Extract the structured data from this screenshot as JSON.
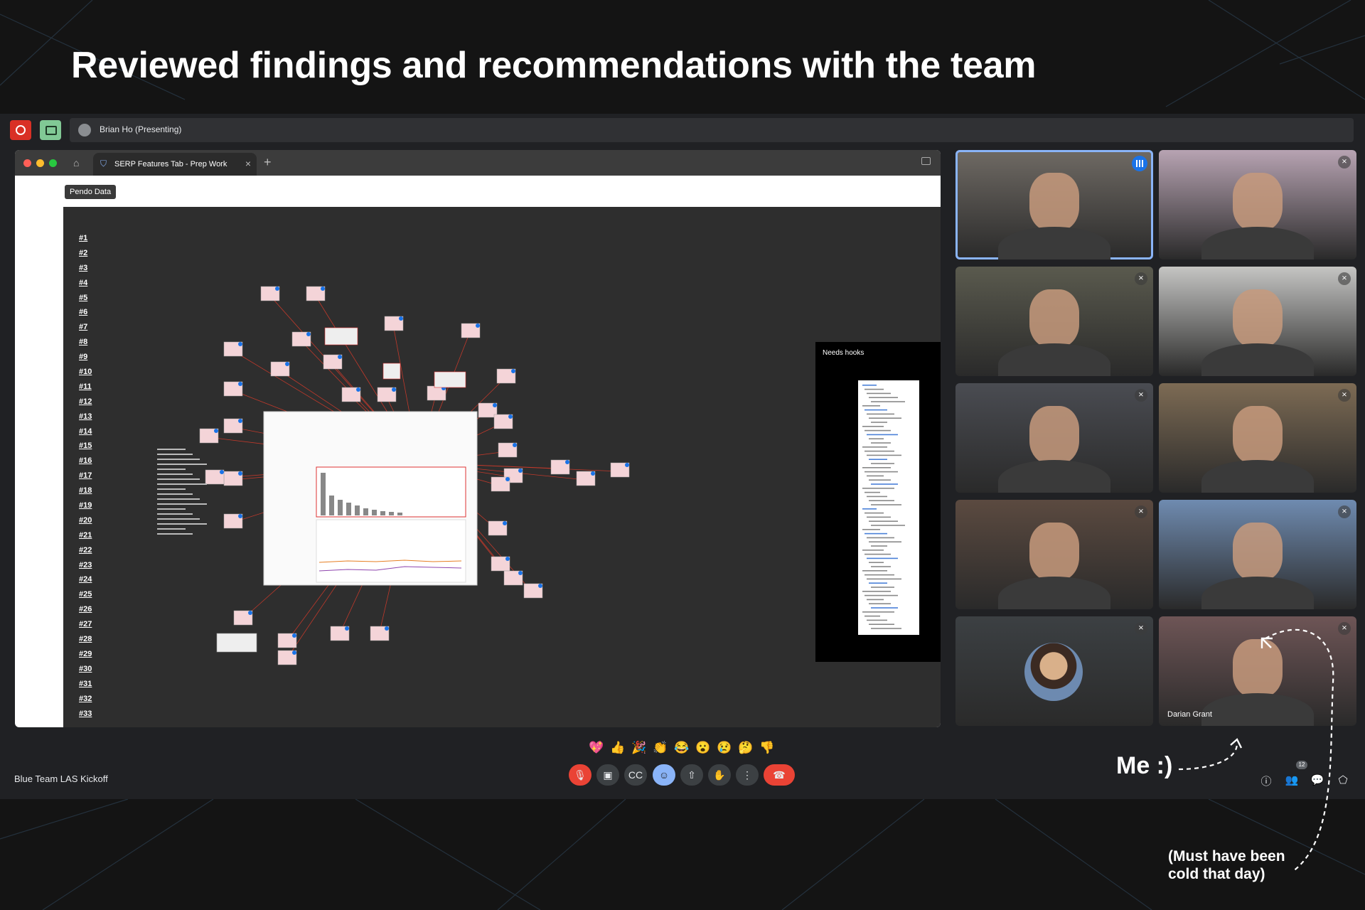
{
  "headline": "Reviewed findings and recommendations with the team",
  "meet": {
    "presenting_label": "Brian Ho (Presenting)",
    "meeting_title": "Blue Team LAS Kickoff",
    "participant_count": "12",
    "reactions": [
      "💖",
      "👍",
      "🎉",
      "👏",
      "😂",
      "😮",
      "😢",
      "🤔",
      "👎"
    ],
    "controls": [
      {
        "name": "mic-off",
        "glyph": "🎙"
      },
      {
        "name": "camera",
        "glyph": "▣"
      },
      {
        "name": "captions",
        "glyph": "CC"
      },
      {
        "name": "emoji",
        "glyph": "☺"
      },
      {
        "name": "present",
        "glyph": "⇧"
      },
      {
        "name": "raise-hand",
        "glyph": "✋"
      },
      {
        "name": "more",
        "glyph": "⋮"
      },
      {
        "name": "hang-up",
        "glyph": "☎"
      }
    ],
    "tiles": [
      {
        "name": "",
        "speaking": true,
        "muted": false,
        "bg": "#6f6a64"
      },
      {
        "name": "",
        "speaking": false,
        "muted": true,
        "bg": "#b7a3b2"
      },
      {
        "name": "",
        "speaking": false,
        "muted": true,
        "bg": "#5a5a4e"
      },
      {
        "name": "",
        "speaking": false,
        "muted": true,
        "bg": "#c5c5c3"
      },
      {
        "name": "",
        "speaking": false,
        "muted": true,
        "bg": "#4a4c52"
      },
      {
        "name": "",
        "speaking": false,
        "muted": true,
        "bg": "#7d6b54"
      },
      {
        "name": "",
        "speaking": false,
        "muted": true,
        "bg": "#5b4a40"
      },
      {
        "name": "",
        "speaking": false,
        "muted": true,
        "bg": "#6f8bb0"
      },
      {
        "name": "",
        "speaking": false,
        "muted": true,
        "bg": "#3c4043",
        "avatar": true
      },
      {
        "name": "Darian Grant",
        "speaking": false,
        "muted": true,
        "bg": "#6e5556"
      }
    ]
  },
  "browser": {
    "tab_label": "SERP Features Tab - Prep Work",
    "pendo_chip": "Pendo Data",
    "row_numbers": [
      "#1",
      "#2",
      "#3",
      "#4",
      "#5",
      "#6",
      "#7",
      "#8",
      "#9",
      "#10",
      "#11",
      "#12",
      "#13",
      "#14",
      "#15",
      "#16",
      "#17",
      "#18",
      "#19",
      "#20",
      "#21",
      "#22",
      "#23",
      "#24",
      "#25",
      "#26",
      "#27",
      "#28",
      "#29",
      "#30",
      "#31",
      "#32",
      "#33"
    ],
    "needs_hooks_label": "Needs hooks"
  },
  "annotations": {
    "me_label": "Me :)",
    "cold_note": "(Must have been cold that day)"
  },
  "colors": {
    "background": "#141414",
    "meet_bg": "#202124",
    "accent_blue": "#8ab4f8",
    "red": "#ea4335",
    "sticky": "#f4d4d8"
  }
}
